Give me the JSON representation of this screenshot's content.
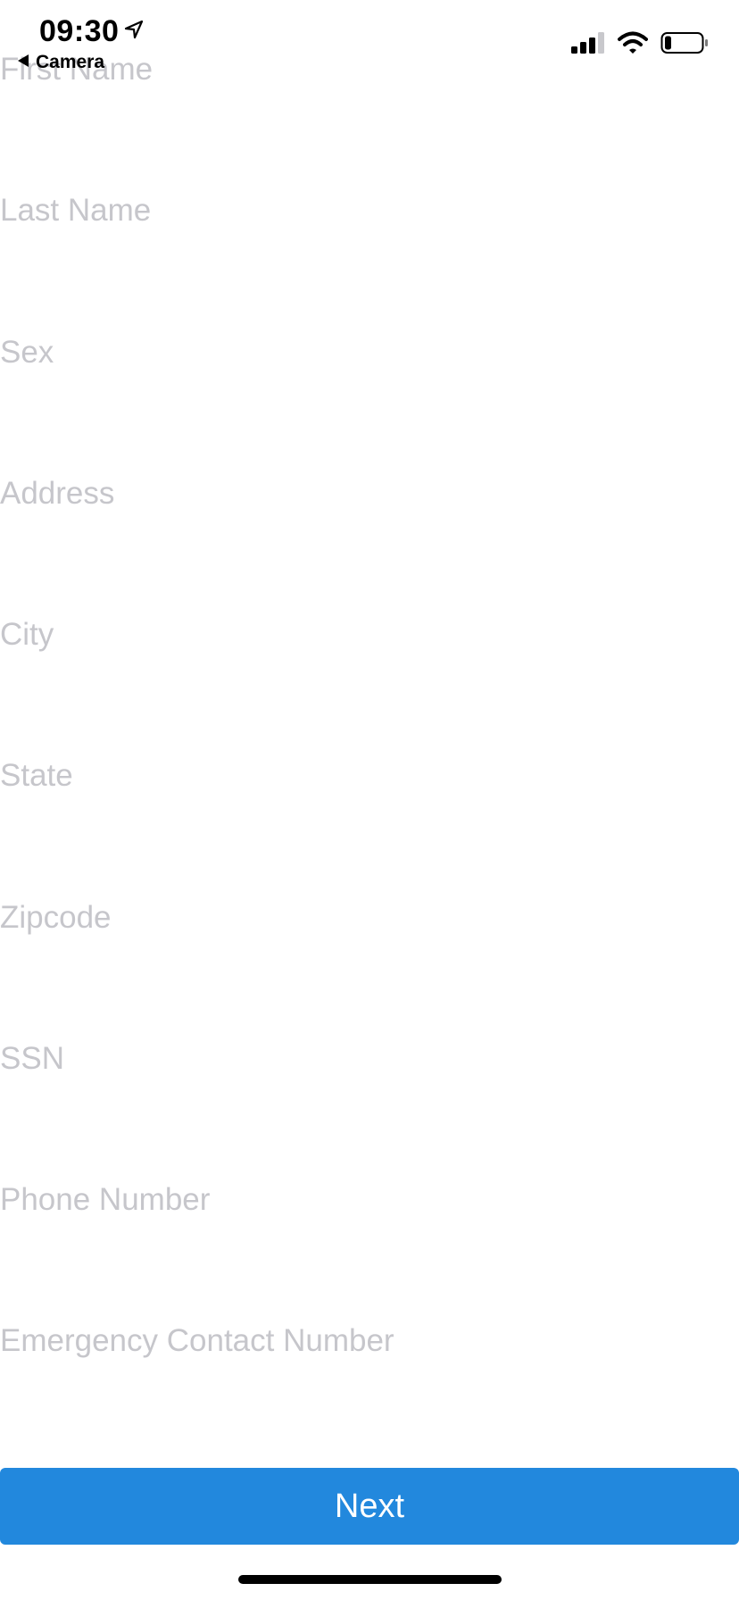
{
  "status_bar": {
    "time": "09:30",
    "back_label": "Camera",
    "location_icon": "location-arrow-icon",
    "signal_icon": "cellular-signal-icon",
    "wifi_icon": "wifi-icon",
    "battery_icon": "battery-low-icon"
  },
  "form": {
    "fields": [
      {
        "placeholder": "First Name",
        "value": ""
      },
      {
        "placeholder": "Last Name",
        "value": ""
      },
      {
        "placeholder": "Sex",
        "value": ""
      },
      {
        "placeholder": "Address",
        "value": ""
      },
      {
        "placeholder": "City",
        "value": ""
      },
      {
        "placeholder": "State",
        "value": ""
      },
      {
        "placeholder": "Zipcode",
        "value": ""
      },
      {
        "placeholder": "SSN",
        "value": ""
      },
      {
        "placeholder": "Phone Number",
        "value": ""
      },
      {
        "placeholder": "Emergency Contact Number",
        "value": ""
      }
    ]
  },
  "next_button": {
    "label": "Next"
  },
  "colors": {
    "accent": "#2288dd",
    "placeholder": "#c6c6cb",
    "background": "#ffffff"
  }
}
